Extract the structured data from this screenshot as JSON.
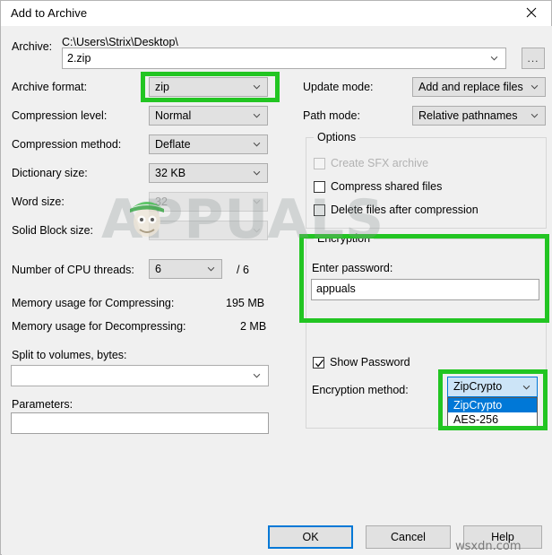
{
  "window": {
    "title": "Add to Archive",
    "close_icon": "close-icon"
  },
  "archive": {
    "label": "Archive:",
    "path_text": "C:\\Users\\Strix\\Desktop\\",
    "value": "2.zip",
    "browse_label": "...",
    "chevron_icon": "chevron-down-icon"
  },
  "left_fields": {
    "archive_format": {
      "label": "Archive format:",
      "value": "zip"
    },
    "compression_level": {
      "label": "Compression level:",
      "value": "Normal"
    },
    "compression_method": {
      "label": "Compression method:",
      "value": "Deflate"
    },
    "dictionary_size": {
      "label": "Dictionary size:",
      "value": "32 KB"
    },
    "word_size": {
      "label": "Word size:",
      "value": "32"
    },
    "solid_block_size": {
      "label": "Solid Block size:",
      "value": ""
    },
    "cpu_threads": {
      "label": "Number of CPU threads:",
      "value": "6",
      "suffix": "/ 6"
    },
    "memory_compress": {
      "label": "Memory usage for Compressing:",
      "value": "195 MB"
    },
    "memory_decompress": {
      "label": "Memory usage for Decompressing:",
      "value": "2 MB"
    },
    "split_volumes": {
      "label": "Split to volumes, bytes:",
      "value": ""
    },
    "parameters": {
      "label": "Parameters:",
      "value": ""
    }
  },
  "right_fields": {
    "update_mode": {
      "label": "Update mode:",
      "value": "Add and replace files"
    },
    "path_mode": {
      "label": "Path mode:",
      "value": "Relative pathnames"
    }
  },
  "options_group": {
    "legend": "Options",
    "items": [
      {
        "label": "Create SFX archive",
        "checked": false,
        "disabled": true
      },
      {
        "label": "Compress shared files",
        "checked": false,
        "disabled": false
      },
      {
        "label": "Delete files after compression",
        "checked": false,
        "disabled": false
      }
    ]
  },
  "encryption_group": {
    "legend": "Encryption",
    "password_label": "Enter password:",
    "password_value": "appuals",
    "show_password": {
      "label": "Show Password",
      "checked": true
    },
    "method_label": "Encryption method:",
    "method_value": "ZipCrypto",
    "method_options": [
      {
        "label": "ZipCrypto",
        "selected": true
      },
      {
        "label": "AES-256",
        "selected": false
      }
    ]
  },
  "buttons": {
    "ok": "OK",
    "cancel": "Cancel",
    "help": "Help"
  },
  "annotations": {
    "highlight_color": "#22c522",
    "accent_color": "#0078d7"
  },
  "watermarks": {
    "appuals": "APPUALS",
    "wsxdn": "wsxdn.com"
  }
}
